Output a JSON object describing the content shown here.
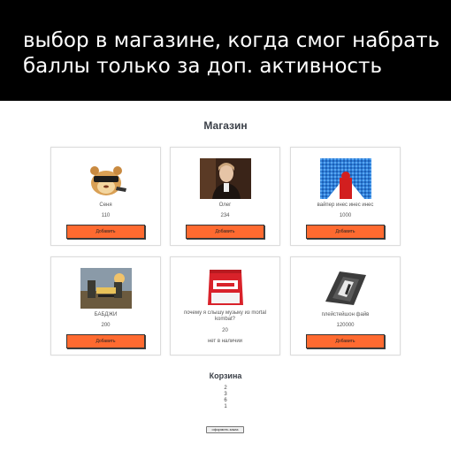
{
  "caption": {
    "line1": "выбор в магазине, когда смог набрать",
    "line2": "баллы только за доп. активность"
  },
  "shop": {
    "title": "Магазин",
    "add_label": "Добавить",
    "items": [
      {
        "name": "Сеня",
        "price": "110",
        "image": "hamster-sunglasses-image"
      },
      {
        "name": "Олег",
        "price": "234",
        "image": "man-portrait-image"
      },
      {
        "name": "вайпер инес инес инес",
        "price": "1000",
        "image": "red-figure-pixel-image"
      },
      {
        "name": "БАБДЖИ",
        "price": "200",
        "image": "pubg-game-cover-image"
      },
      {
        "name": "почему я слышу музыку из mortal kombat?",
        "price": "20",
        "stock": "нет в наличии",
        "image": "red-snack-bag-image"
      },
      {
        "name": "плейстейшон файв",
        "price": "120000",
        "image": "game-console-image"
      }
    ]
  },
  "cart": {
    "title": "Корзина",
    "items": [
      "2",
      "3",
      "6",
      "1"
    ],
    "order_label": "оформить заказ"
  },
  "colors": {
    "caption_bg": "#000000",
    "add_button": "#ff6a30"
  }
}
